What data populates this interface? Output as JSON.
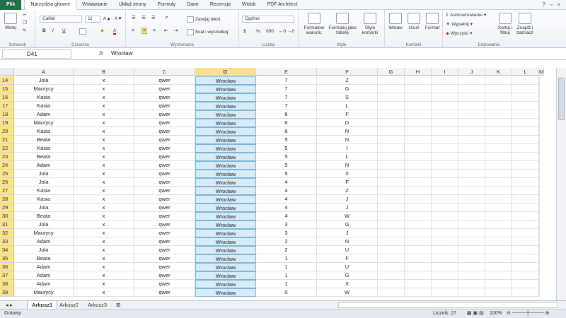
{
  "tabs": [
    "Plik",
    "Narzędzia główne",
    "Wstawianie",
    "Układ strony",
    "Formuły",
    "Dane",
    "Recenzja",
    "Widok",
    "PDF Architect"
  ],
  "ribbon": {
    "clipboard": {
      "label": "Schowek",
      "paste": "Wklej"
    },
    "font": {
      "label": "Czcionka",
      "name": "Calibri",
      "size": "11",
      "bold": "B",
      "italic": "I",
      "underline": "U"
    },
    "alignment": {
      "label": "Wyrównanie",
      "wrap": "Zawijaj tekst",
      "merge": "Scal i wyśrodkuj"
    },
    "number": {
      "label": "Liczba",
      "format": "Ogólne",
      "currency": "$",
      "percent": "%",
      "thousands": "000"
    },
    "styles": {
      "label": "Style",
      "conditional": "Formatow warunk.",
      "as_table": "Formatuj jako tabelę",
      "cell_styles": "Style komórki"
    },
    "cells": {
      "label": "Komórki",
      "insert": "Wstaw",
      "delete": "Usuń",
      "format": "Format"
    },
    "editing": {
      "label": "Edytowanie",
      "autosum": "Autosumowanie",
      "fill": "Wypełnij",
      "clear": "Wyczyść",
      "sort": "Sortuj i filtruj",
      "find": "Znajdź i zaznacz"
    }
  },
  "formula_bar": {
    "name_box": "D41",
    "fx": "fx",
    "value": "Wrocław"
  },
  "columns": [
    "A",
    "B",
    "C",
    "D",
    "E",
    "F",
    "G",
    "H",
    "I",
    "J",
    "K",
    "L",
    "M"
  ],
  "rows": [
    {
      "n": "14",
      "a": "Jola",
      "b": "x",
      "c": "qwer",
      "d": "Wrocław",
      "e": "7",
      "f": "Z"
    },
    {
      "n": "15",
      "a": "Maurycy",
      "b": "x",
      "c": "qwer",
      "d": "Wrocław",
      "e": "7",
      "f": "G"
    },
    {
      "n": "16",
      "a": "Kasia",
      "b": "x",
      "c": "qwer",
      "d": "Wrocław",
      "e": "7",
      "f": "S"
    },
    {
      "n": "17",
      "a": "Kasia",
      "b": "x",
      "c": "qwer",
      "d": "Wrocław",
      "e": "7",
      "f": "L"
    },
    {
      "n": "18",
      "a": "Adam",
      "b": "x",
      "c": "qwer",
      "d": "Wrocław",
      "e": "6",
      "f": "F"
    },
    {
      "n": "19",
      "a": "Maurycy",
      "b": "x",
      "c": "qwer",
      "d": "Wrocław",
      "e": "6",
      "f": "D"
    },
    {
      "n": "20",
      "a": "Kasia",
      "b": "x",
      "c": "qwer",
      "d": "Wrocław",
      "e": "6",
      "f": "N"
    },
    {
      "n": "21",
      "a": "Beata",
      "b": "x",
      "c": "qwer",
      "d": "Wrocław",
      "e": "5",
      "f": "N"
    },
    {
      "n": "22",
      "a": "Kasia",
      "b": "x",
      "c": "qwer",
      "d": "Wrocław",
      "e": "5",
      "f": "I"
    },
    {
      "n": "23",
      "a": "Beata",
      "b": "x",
      "c": "qwer",
      "d": "Wrocław",
      "e": "5",
      "f": "L"
    },
    {
      "n": "24",
      "a": "Adam",
      "b": "x",
      "c": "qwer",
      "d": "Wrocław",
      "e": "5",
      "f": "N"
    },
    {
      "n": "25",
      "a": "Jola",
      "b": "x",
      "c": "qwer",
      "d": "Wrocław",
      "e": "5",
      "f": "X"
    },
    {
      "n": "26",
      "a": "Jola",
      "b": "x",
      "c": "qwer",
      "d": "Wrocław",
      "e": "4",
      "f": "F"
    },
    {
      "n": "27",
      "a": "Kasia",
      "b": "x",
      "c": "qwer",
      "d": "Wrocław",
      "e": "4",
      "f": "Z"
    },
    {
      "n": "28",
      "a": "Kasia",
      "b": "x",
      "c": "qwer",
      "d": "Wrocław",
      "e": "4",
      "f": "J"
    },
    {
      "n": "29",
      "a": "Jola",
      "b": "x",
      "c": "qwer",
      "d": "Wrocław",
      "e": "4",
      "f": "J"
    },
    {
      "n": "30",
      "a": "Beata",
      "b": "x",
      "c": "qwer",
      "d": "Wrocław",
      "e": "4",
      "f": "W"
    },
    {
      "n": "31",
      "a": "Jola",
      "b": "x",
      "c": "qwer",
      "d": "Wrocław",
      "e": "3",
      "f": "G"
    },
    {
      "n": "32",
      "a": "Maurycy",
      "b": "x",
      "c": "qwer",
      "d": "Wrocław",
      "e": "3",
      "f": "J"
    },
    {
      "n": "33",
      "a": "Adam",
      "b": "x",
      "c": "qwer",
      "d": "Wrocław",
      "e": "2",
      "f": "N"
    },
    {
      "n": "34",
      "a": "Jola",
      "b": "x",
      "c": "qwer",
      "d": "Wrocław",
      "e": "2",
      "f": "U"
    },
    {
      "n": "35",
      "a": "Beata",
      "b": "x",
      "c": "qwer",
      "d": "Wrocław",
      "e": "1",
      "f": "F"
    },
    {
      "n": "36",
      "a": "Adam",
      "b": "x",
      "c": "qwer",
      "d": "Wrocław",
      "e": "1",
      "f": "U"
    },
    {
      "n": "37",
      "a": "Adam",
      "b": "x",
      "c": "qwer",
      "d": "Wrocław",
      "e": "1",
      "f": "G"
    },
    {
      "n": "38",
      "a": "Adam",
      "b": "x",
      "c": "qwer",
      "d": "Wrocław",
      "e": "1",
      "f": "X"
    },
    {
      "n": "39",
      "a": "Maurycy",
      "b": "x",
      "c": "qwer",
      "d": "Wrocław",
      "e": "0",
      "f": "W"
    }
  ],
  "sheets": [
    "Arkusz1",
    "Arkusz2",
    "Arkusz3"
  ],
  "status": {
    "ready": "Gotowy",
    "count": "Licznik: 27",
    "zoom": "100%"
  },
  "colors": {
    "file_tab": "#1e7145",
    "selected_header": "#f8e08e",
    "selected_cell": "#d7ebf7"
  }
}
